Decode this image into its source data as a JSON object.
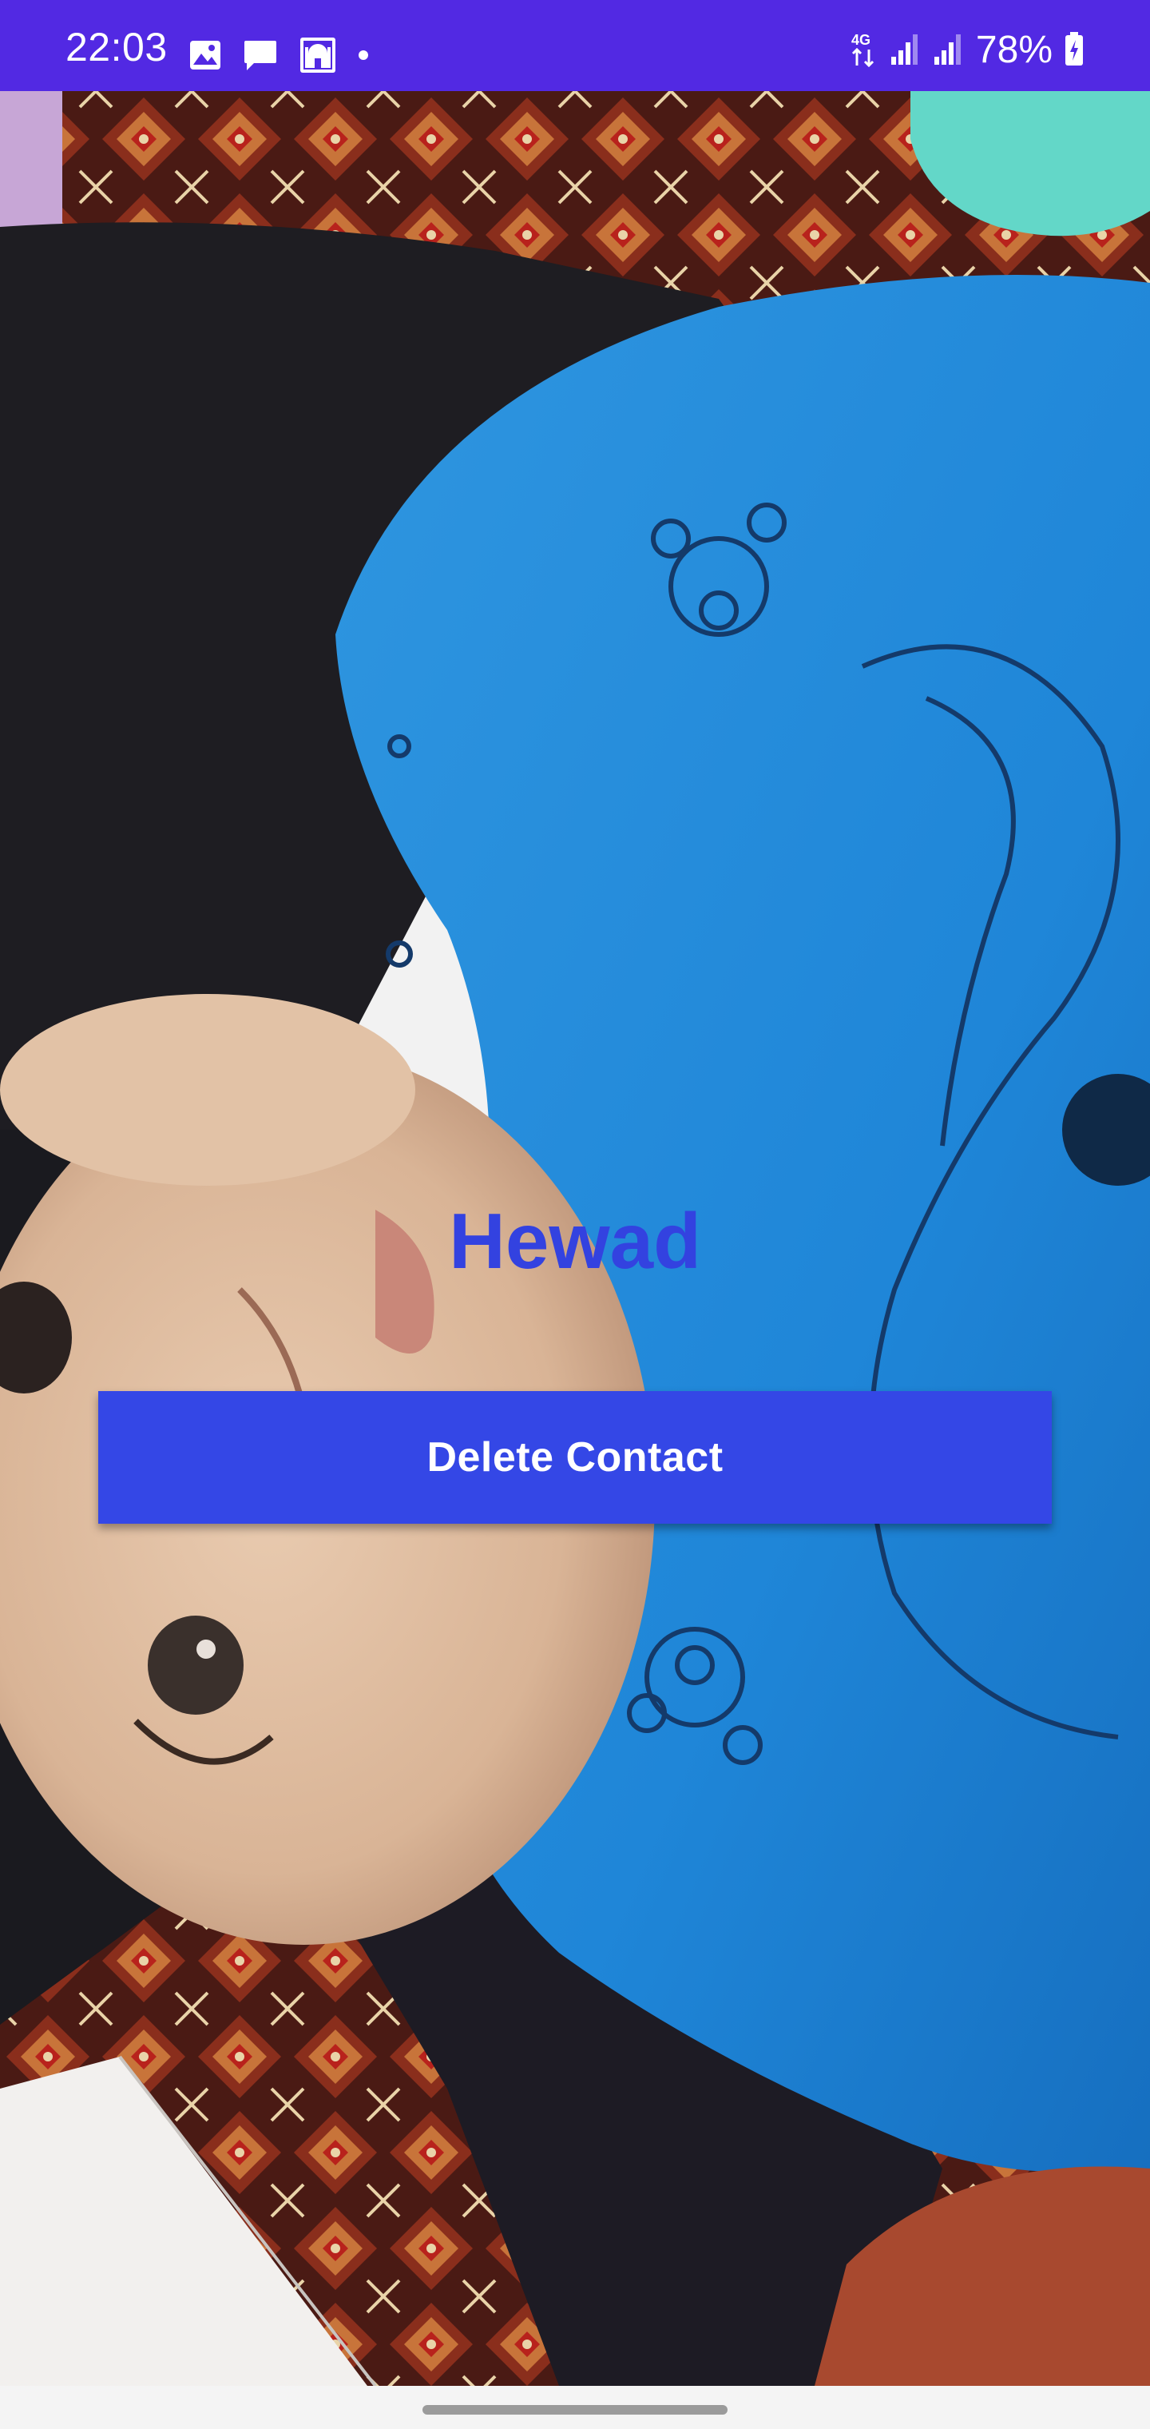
{
  "status_bar": {
    "time": "22:03",
    "battery": "78%",
    "network": "4G",
    "icons_left": [
      "gallery-icon",
      "message-icon",
      "mosque-app-icon",
      "notification-dot-icon"
    ],
    "icons_right": [
      "network-4g-icon",
      "signal-sim1-icon",
      "signal-sim2-icon",
      "battery-charging-icon"
    ],
    "color": "#5229e3"
  },
  "contact": {
    "name": "Hewad",
    "name_color": "#3342e0"
  },
  "actions": {
    "delete_label": "Delete Contact",
    "button_color": "#3447e6"
  }
}
